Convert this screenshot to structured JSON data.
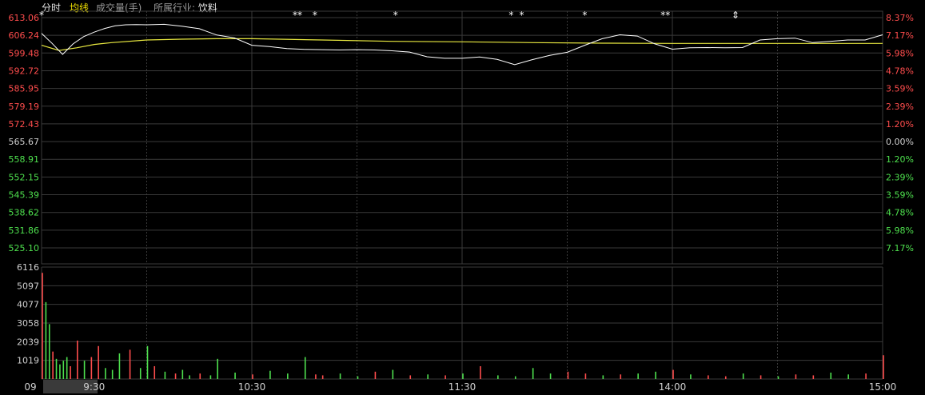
{
  "header": {
    "time_tab": "分时",
    "avg_line_label": "均线",
    "volume_label": "成交量(手)",
    "industry_label": "所属行业:",
    "industry_value": "饮料"
  },
  "colors": {
    "background": "#000000",
    "grid": "#3a3a3a",
    "up": "#ff4d4d",
    "down": "#4ee04e",
    "flat": "#d0d0d0",
    "price_line": "#ffffff",
    "avg_line": "#e8e840",
    "marker": "#ffffff",
    "time_label_bg": "#3a3a3a"
  },
  "chart_data": {
    "type": "line",
    "grid": true,
    "prev_close": 565.67,
    "price_axis_left": [
      "613.06",
      "606.24",
      "599.48",
      "592.72",
      "585.95",
      "579.19",
      "572.43",
      "565.67",
      "558.91",
      "552.15",
      "545.39",
      "538.62",
      "531.86",
      "525.10"
    ],
    "pct_axis_right": [
      "8.37%",
      "7.17%",
      "5.98%",
      "4.78%",
      "3.59%",
      "2.39%",
      "1.20%",
      "0.00%",
      "1.20%",
      "2.39%",
      "3.59%",
      "4.78%",
      "5.98%",
      "7.17%"
    ],
    "ylim": [
      525.1,
      613.06
    ],
    "volume_axis": [
      "6116",
      "5097",
      "4077",
      "3058",
      "2039",
      "1019"
    ],
    "volume_ylim": [
      0,
      6116
    ],
    "time_labels": [
      "09",
      "9:30",
      "10:30",
      "11:30",
      "14:00",
      "15:00"
    ],
    "price_series": {
      "name": "分时",
      "x": [
        0,
        3,
        6,
        9,
        12,
        15,
        18,
        21,
        24,
        27,
        30,
        35,
        40,
        45,
        50,
        55,
        60,
        65,
        70,
        75,
        80,
        85,
        90,
        95,
        100,
        105,
        110,
        115,
        120,
        125,
        130,
        135,
        140,
        145,
        150,
        155,
        160,
        165,
        170,
        175,
        180,
        185,
        190,
        195,
        200,
        205,
        210,
        215,
        220,
        225,
        230,
        235,
        240
      ],
      "values": [
        607.0,
        603.2,
        599.0,
        603.0,
        605.8,
        607.5,
        608.9,
        609.9,
        610.3,
        610.4,
        610.3,
        610.5,
        609.8,
        608.8,
        606.4,
        605.3,
        602.5,
        602.0,
        601.2,
        600.9,
        600.8,
        600.7,
        600.8,
        600.7,
        600.4,
        599.9,
        598.1,
        597.5,
        597.5,
        598.0,
        597.1,
        595.1,
        597.0,
        598.6,
        599.8,
        602.5,
        605.0,
        606.5,
        606.0,
        603.0,
        601.0,
        601.5,
        601.6,
        601.5,
        601.6,
        604.5,
        605.0,
        605.2,
        603.5,
        604.0,
        604.5,
        604.5,
        606.5
      ]
    },
    "avg_series": {
      "name": "均线",
      "x": [
        0,
        5,
        10,
        15,
        20,
        30,
        40,
        50,
        60,
        80,
        100,
        120,
        140,
        160,
        180,
        200,
        220,
        240
      ],
      "values": [
        602.5,
        600.5,
        601.5,
        602.8,
        603.5,
        604.5,
        604.8,
        605.0,
        605.0,
        604.5,
        604.0,
        603.8,
        603.5,
        603.3,
        603.2,
        603.2,
        603.2,
        603.2
      ]
    },
    "volume_series": {
      "name": "成交量",
      "x": [
        0,
        1,
        2,
        3,
        4,
        5,
        6,
        7,
        8,
        10,
        12,
        14,
        16,
        18,
        20,
        22,
        25,
        28,
        30,
        32,
        35,
        38,
        40,
        42,
        45,
        48,
        50,
        55,
        60,
        65,
        70,
        75,
        78,
        80,
        85,
        90,
        95,
        100,
        105,
        110,
        115,
        120,
        125,
        130,
        135,
        140,
        145,
        150,
        155,
        160,
        165,
        170,
        175,
        180,
        185,
        190,
        195,
        200,
        205,
        210,
        215,
        220,
        225,
        230,
        235,
        240
      ],
      "values": [
        5800,
        4200,
        3000,
        1500,
        1100,
        800,
        1000,
        1200,
        700,
        2100,
        1000,
        1200,
        1800,
        600,
        500,
        1400,
        1600,
        600,
        1800,
        700,
        400,
        300,
        500,
        200,
        300,
        200,
        1100,
        350,
        250,
        450,
        300,
        1200,
        250,
        200,
        300,
        150,
        400,
        500,
        200,
        250,
        200,
        300,
        700,
        200,
        150,
        600,
        300,
        400,
        300,
        200,
        250,
        300,
        400,
        500,
        250,
        200,
        150,
        300,
        200,
        150,
        250,
        200,
        350,
        250,
        300,
        1300
      ],
      "dirs": [
        "u",
        "d",
        "d",
        "u",
        "d",
        "d",
        "d",
        "d",
        "u",
        "u",
        "d",
        "u",
        "u",
        "d",
        "d",
        "d",
        "u",
        "d",
        "d",
        "u",
        "d",
        "u",
        "d",
        "d",
        "u",
        "d",
        "d",
        "d",
        "u",
        "d",
        "d",
        "d",
        "u",
        "u",
        "d",
        "d",
        "u",
        "d",
        "u",
        "d",
        "u",
        "d",
        "u",
        "d",
        "d",
        "d",
        "d",
        "u",
        "u",
        "d",
        "u",
        "d",
        "d",
        "u",
        "d",
        "u",
        "u",
        "d",
        "u",
        "d",
        "u",
        "u",
        "d",
        "d",
        "u",
        "u"
      ]
    },
    "markers": [
      {
        "x": 0,
        "symbol": "*"
      },
      {
        "x": 73,
        "symbol": "**"
      },
      {
        "x": 78,
        "symbol": "*"
      },
      {
        "x": 101,
        "symbol": "*"
      },
      {
        "x": 134,
        "symbol": "*"
      },
      {
        "x": 137,
        "symbol": "*"
      },
      {
        "x": 155,
        "symbol": "*"
      },
      {
        "x": 178,
        "symbol": "**"
      },
      {
        "x": 198,
        "symbol": "⇕"
      }
    ]
  }
}
